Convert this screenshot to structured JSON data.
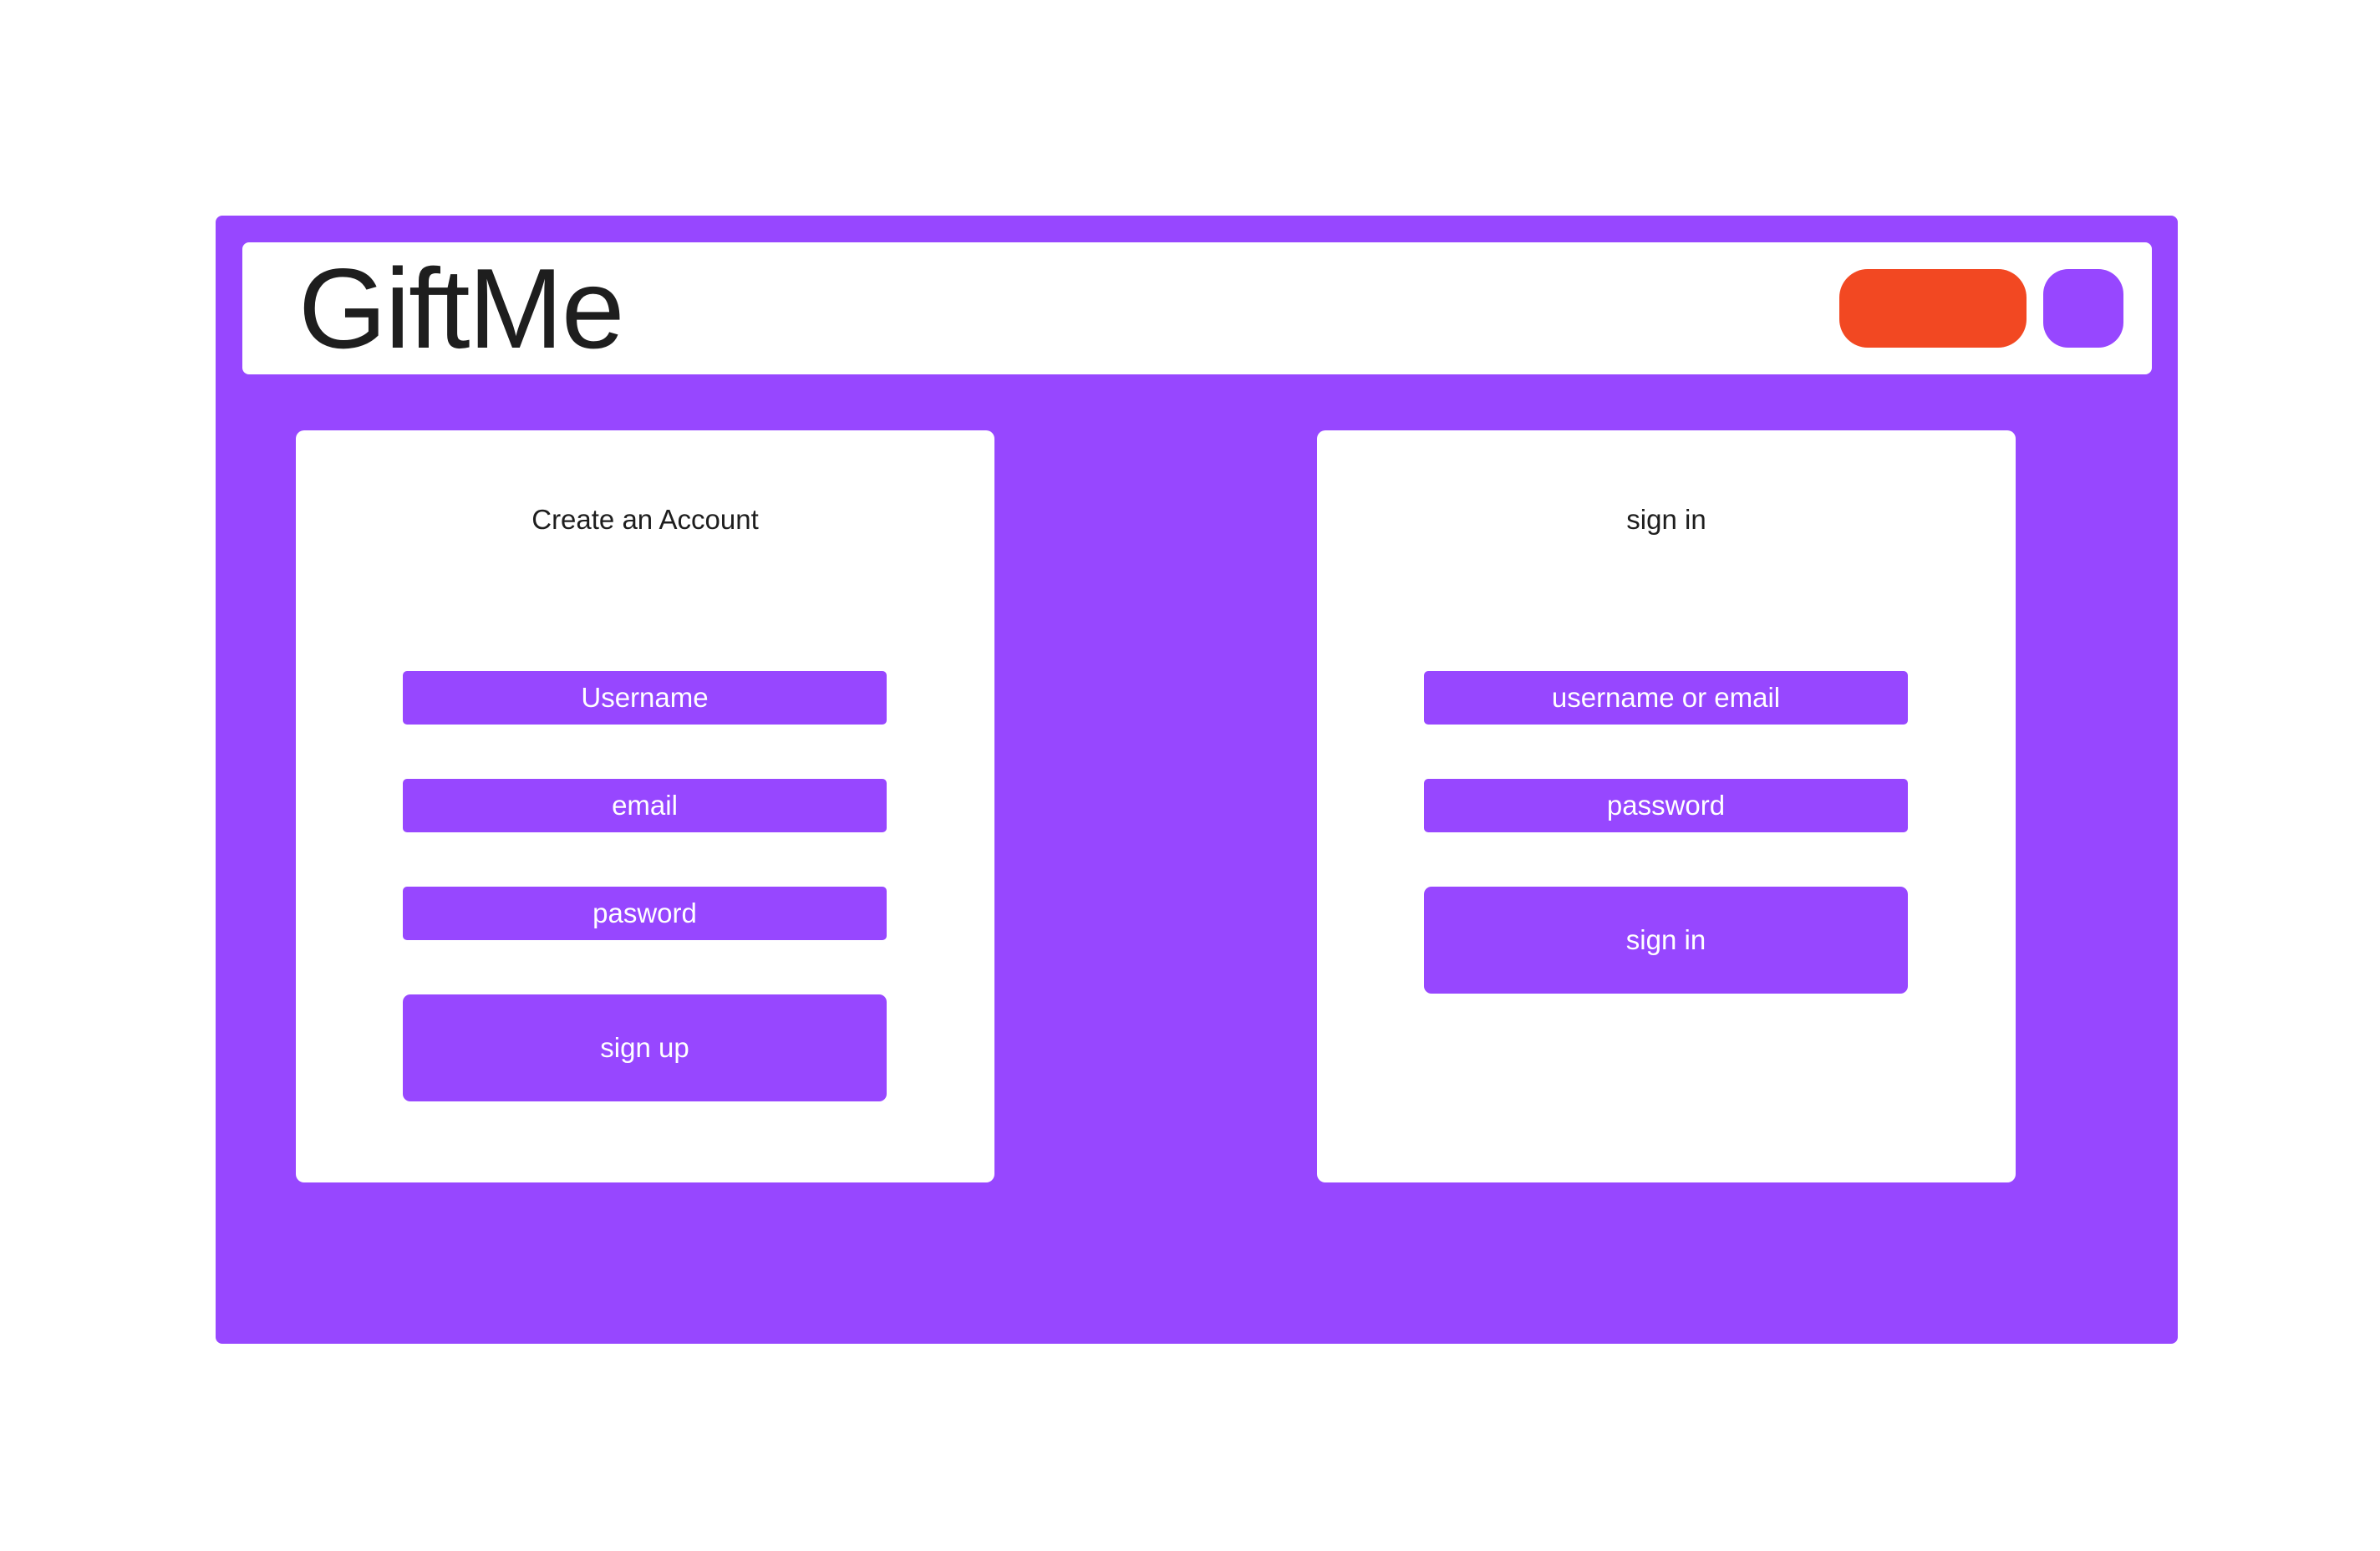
{
  "app": {
    "title": "GiftMe"
  },
  "colors": {
    "accent": "#9747ff",
    "header_button": "#f24822",
    "text": "#1e1e1e",
    "surface": "#ffffff"
  },
  "signup": {
    "title": "Create an Account",
    "username_placeholder": "Username",
    "email_placeholder": "email",
    "password_placeholder": "pasword",
    "submit_label": "sign up"
  },
  "signin": {
    "title": "sign in",
    "identifier_placeholder": "username or email",
    "password_placeholder": "password",
    "submit_label": "sign in"
  }
}
